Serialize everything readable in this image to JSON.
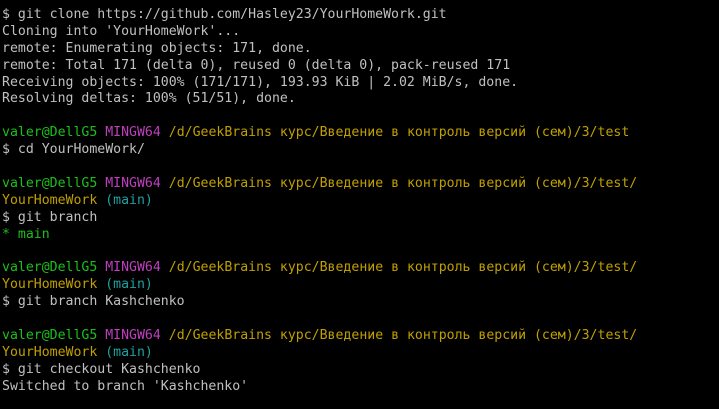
{
  "colors": {
    "background": "#000000",
    "text": "#c0c0c0",
    "user_host": "#1bc01b",
    "shell": "#bf3fbf",
    "path": "#c0a000",
    "branch": "#20a0a0"
  },
  "lines": [
    {
      "type": "command",
      "text": "$ git clone https://github.com/Hasley23/YourHomeWork.git"
    },
    {
      "type": "output",
      "text": "Cloning into 'YourHomeWork'..."
    },
    {
      "type": "output",
      "text": "remote: Enumerating objects: 171, done."
    },
    {
      "type": "output",
      "text": "remote: Total 171 (delta 0), reused 0 (delta 0), pack-reused 171"
    },
    {
      "type": "output",
      "text": "Receiving objects: 100% (171/171), 193.93 KiB | 2.02 MiB/s, done."
    },
    {
      "type": "output",
      "text": "Resolving deltas: 100% (51/51), done."
    },
    {
      "type": "blank",
      "text": ""
    },
    {
      "type": "prompt",
      "user": "valer@DellG5",
      "shell": "MINGW64",
      "path": "/d/GeekBrains курс/Введение в контроль версий (сем)/3/test"
    },
    {
      "type": "command",
      "text": "$ cd YourHomeWork/"
    },
    {
      "type": "blank",
      "text": ""
    },
    {
      "type": "prompt",
      "user": "valer@DellG5",
      "shell": "MINGW64",
      "path": "/d/GeekBrains курс/Введение в контроль версий (сем)/3/test/"
    },
    {
      "type": "prompt-cont",
      "path": "YourHomeWork",
      "branch": "(main)"
    },
    {
      "type": "command",
      "text": "$ git branch"
    },
    {
      "type": "branch-output",
      "text": "* main"
    },
    {
      "type": "blank",
      "text": ""
    },
    {
      "type": "prompt",
      "user": "valer@DellG5",
      "shell": "MINGW64",
      "path": "/d/GeekBrains курс/Введение в контроль версий (сем)/3/test/"
    },
    {
      "type": "prompt-cont",
      "path": "YourHomeWork",
      "branch": "(main)"
    },
    {
      "type": "command",
      "text": "$ git branch Kashchenko"
    },
    {
      "type": "blank",
      "text": ""
    },
    {
      "type": "prompt",
      "user": "valer@DellG5",
      "shell": "MINGW64",
      "path": "/d/GeekBrains курс/Введение в контроль версий (сем)/3/test/"
    },
    {
      "type": "prompt-cont",
      "path": "YourHomeWork",
      "branch": "(main)"
    },
    {
      "type": "command",
      "text": "$ git checkout Kashchenko"
    },
    {
      "type": "output",
      "text": "Switched to branch 'Kashchenko'"
    }
  ]
}
